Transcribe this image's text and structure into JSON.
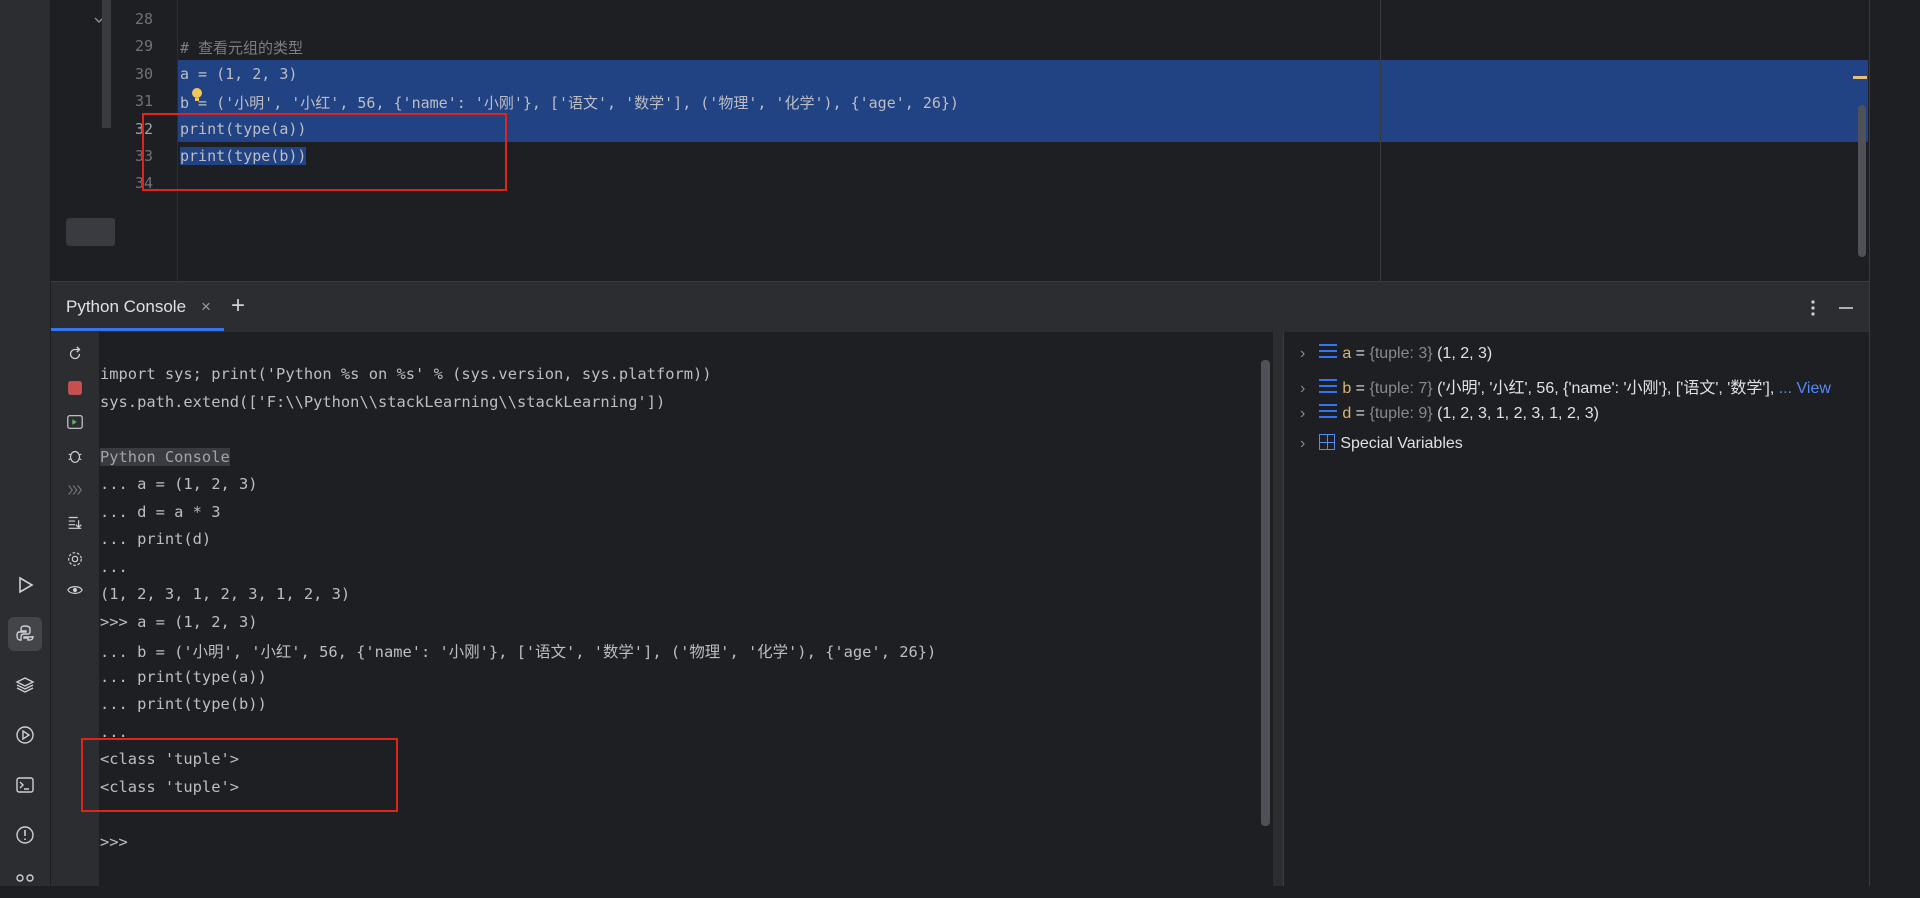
{
  "editor": {
    "lines": [
      {
        "num": "28",
        "text": ""
      },
      {
        "num": "29",
        "text": "# 查看元组的类型"
      },
      {
        "num": "30",
        "text": "a = (1, 2, 3)"
      },
      {
        "num": "31",
        "text": "b = ('小明', '小红', 56, {'name': '小刚'}, ['语文', '数学'], ('物理', '化学'), {'age', 26})"
      },
      {
        "num": "32",
        "text": "print(type(a))"
      },
      {
        "num": "33",
        "text": "print(type(b))"
      },
      {
        "num": "34",
        "text": ""
      }
    ]
  },
  "tool_window": {
    "tab_label": "Python Console",
    "close_symbol": "×",
    "add_symbol": "+"
  },
  "console": {
    "lines": [
      "import sys; print('Python %s on %s' % (sys.version, sys.platform))",
      "sys.path.extend(['F:\\\\Python\\\\stackLearning\\\\stackLearning'])",
      "",
      "Python Console",
      "... a = (1, 2, 3)",
      "... d = a * 3",
      "... print(d)",
      "...",
      "(1, 2, 3, 1, 2, 3, 1, 2, 3)",
      ">>> a = (1, 2, 3)",
      "... b = ('小明', '小红', 56, {'name': '小刚'}, ['语文', '数学'], ('物理', '化学'), {'age', 26})",
      "... print(type(a))",
      "... print(type(b))",
      "...",
      "<class 'tuple'>",
      "<class 'tuple'>",
      "",
      ">>>"
    ]
  },
  "variables": [
    {
      "name": "a",
      "eq": " = ",
      "type": "{tuple: 3}",
      "value": " (1, 2, 3)",
      "link": ""
    },
    {
      "name": "b",
      "eq": " = ",
      "type": "{tuple: 7}",
      "value": " ('小明', '小红', 56, {'name': '小刚'}, ['语文', '数学'], ",
      "link": "... View"
    },
    {
      "name": "d",
      "eq": " = ",
      "type": "{tuple: 9}",
      "value": " (1, 2, 3, 1, 2, 3, 1, 2, 3)",
      "link": ""
    },
    {
      "name": "Special Variables",
      "eq": "",
      "type": "",
      "value": "",
      "link": ""
    }
  ],
  "colors": {
    "selection": "#214283",
    "highlight_box": "#e0241b",
    "accent": "#3574f0"
  }
}
